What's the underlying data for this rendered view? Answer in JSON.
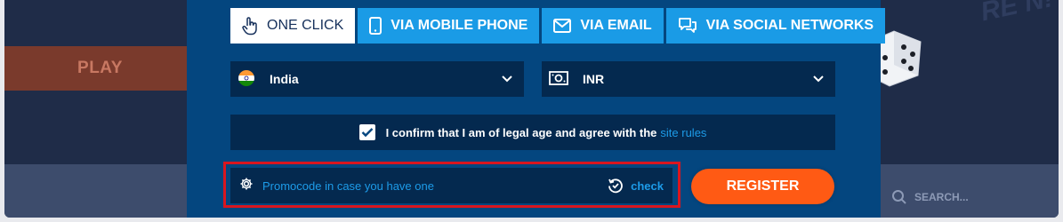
{
  "background": {
    "play_label": "PLAY",
    "deco_text": "RE N!",
    "search_label": "SEARCH..."
  },
  "tabs": [
    {
      "label": "ONE CLICK",
      "icon": "hand-pointer-icon",
      "active": true
    },
    {
      "label": "VIA MOBILE PHONE",
      "icon": "mobile-phone-icon",
      "active": false
    },
    {
      "label": "VIA EMAIL",
      "icon": "envelope-icon",
      "active": false
    },
    {
      "label": "VIA SOCIAL NETWORKS",
      "icon": "chat-bubbles-icon",
      "active": false
    }
  ],
  "country_select": {
    "value": "India",
    "icon": "india-flag-icon"
  },
  "currency_select": {
    "value": "INR",
    "icon": "currency-icon"
  },
  "confirm": {
    "text": "I confirm that I am of legal age and agree with the",
    "link": "site rules",
    "checked": true
  },
  "promo": {
    "placeholder": "Promocode in case you have one",
    "check_label": "check"
  },
  "register_label": "REGISTER",
  "colors": {
    "panel": "#04467f",
    "tab": "#1a9be6",
    "field": "#04294f",
    "accent": "#ff5a14",
    "link": "#1d9be8",
    "highlight": "#d9161f"
  }
}
